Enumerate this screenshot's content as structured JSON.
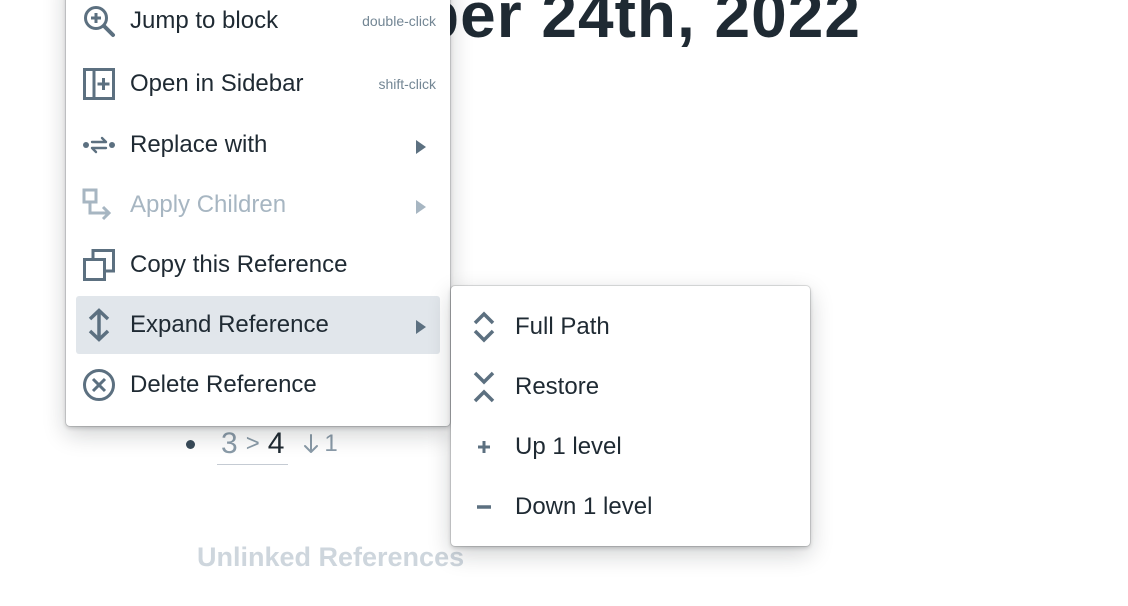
{
  "page": {
    "title": "ber 24th, 2022"
  },
  "reference": {
    "breadcrumb_parent": "3",
    "breadcrumb_separator": ">",
    "breadcrumb_current": "4",
    "ref_count": "1"
  },
  "unlinked_references_label": "Unlinked References",
  "context_menu": {
    "items": [
      {
        "label": "Jump to block",
        "hint": "double-click",
        "icon": "zoom-in-icon"
      },
      {
        "label": "Open in Sidebar",
        "hint": "shift-click",
        "icon": "sidebar-add-icon"
      },
      {
        "label": "Replace with",
        "icon": "swap-icon"
      },
      {
        "label": "Apply Children",
        "icon": "apply-children-icon"
      },
      {
        "label": "Copy this Reference",
        "icon": "duplicate-icon"
      },
      {
        "label": "Expand Reference",
        "icon": "expand-vertical-icon"
      },
      {
        "label": "Delete Reference",
        "icon": "delete-circle-icon"
      }
    ]
  },
  "expand_submenu": {
    "items": [
      {
        "label": "Full Path",
        "icon": "expand-chevrons-icon"
      },
      {
        "label": "Restore",
        "icon": "collapse-chevrons-icon"
      },
      {
        "label": "Up 1 level",
        "icon": "plus-icon"
      },
      {
        "label": "Down 1 level",
        "icon": "minus-icon"
      }
    ]
  },
  "colors": {
    "icon": "#5c7080",
    "active_item_bg": "#e1e6eb",
    "disabled_text": "#a7b6c2",
    "title_text": "#1f2a33"
  }
}
